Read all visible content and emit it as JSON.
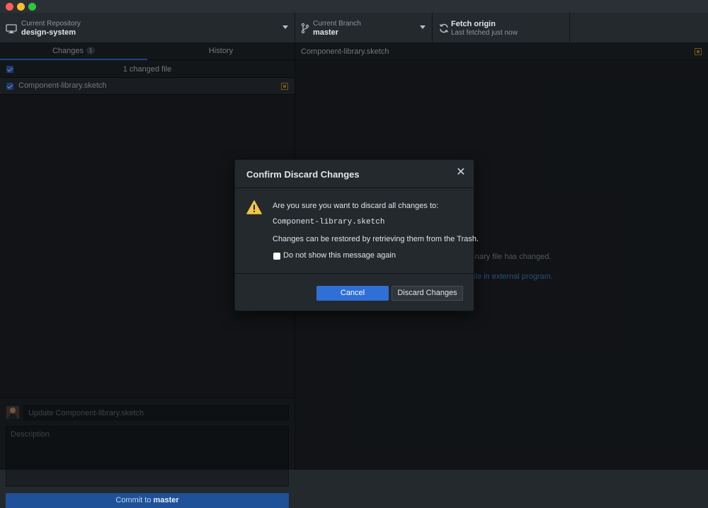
{
  "toolbar": {
    "repository": {
      "top_label": "Current Repository",
      "name": "design-system",
      "icon": "computer-icon"
    },
    "branch": {
      "top_label": "Current Branch",
      "name": "master",
      "icon": "git-branch-icon"
    },
    "fetch": {
      "title": "Fetch origin",
      "subtitle": "Last fetched just now",
      "icon": "sync-icon"
    }
  },
  "sidebar": {
    "tabs": [
      {
        "label": "Changes",
        "count": "1",
        "selected": true
      },
      {
        "label": "History",
        "selected": false
      }
    ],
    "changed_header": "1 changed file",
    "files": [
      {
        "name": "Component-library.sketch",
        "checked": true,
        "status": "modified"
      }
    ],
    "commit": {
      "summary_placeholder": "Update Component-library.sketch",
      "description_placeholder": "Description",
      "button_prefix": "Commit to",
      "button_branch": "master"
    }
  },
  "main": {
    "file_name": "Component-library.sketch",
    "binary_message": "This binary file has changed.",
    "binary_link": "Open file in external program."
  },
  "dialog": {
    "title": "Confirm Discard Changes",
    "close": "✕",
    "question": "Are you sure you want to discard all changes to:",
    "file_name": "Component-library.sketch",
    "restore_note": "Changes can be restored by retrieving them from the Trash.",
    "checkbox_label": "Do not show this message again",
    "checkbox_checked": false,
    "cancel_label": "Cancel",
    "discard_label": "Discard Changes"
  },
  "colors": {
    "accent": "#2f6fd6",
    "modified": "#c99a2e",
    "link": "#4c8fe0"
  }
}
